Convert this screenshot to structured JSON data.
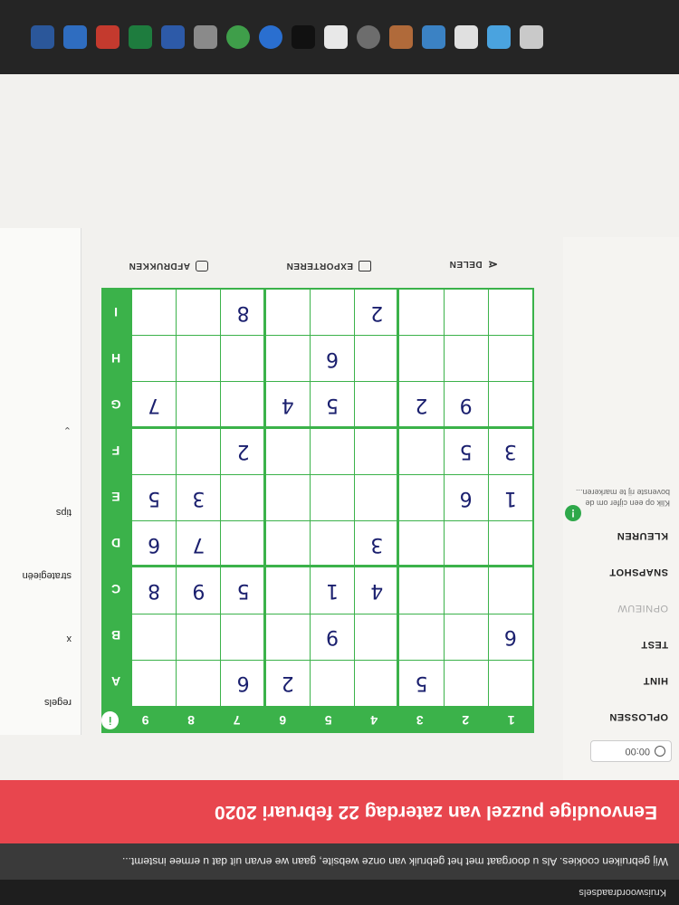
{
  "browser": {
    "tab_title": "Kruiswoordraadsels"
  },
  "cookie_notice": "Wij gebruiken cookies. Als u doorgaat met het gebruik van onze website, gaan we ervan uit dat u ermee instemt...",
  "banner_title": "Eenvoudige puzzel van zaterdag 22 februari 2020",
  "sidebar": {
    "timer": "00:00",
    "buttons": [
      "OPLOSSEN",
      "HINT",
      "TEST",
      "OPNIEUW",
      "SNAPSHOT",
      "KLEUREN"
    ],
    "tip_text": "Klik op een cijfer om de bovenste rij te markeren...",
    "tip_icon": "!"
  },
  "board": {
    "info_icon": "i",
    "columns": [
      "1",
      "2",
      "3",
      "4",
      "5",
      "6",
      "7",
      "8",
      "9"
    ],
    "rows": [
      "A",
      "B",
      "C",
      "D",
      "E",
      "F",
      "G",
      "H",
      "I"
    ],
    "cells": [
      [
        "",
        "",
        "5",
        "",
        "",
        "2",
        "6",
        "",
        ""
      ],
      [
        "6",
        "",
        "",
        "",
        "9",
        "",
        "",
        "",
        ""
      ],
      [
        "",
        "",
        "",
        "4",
        "1",
        "",
        "5",
        "9",
        "8"
      ],
      [
        "",
        "",
        "",
        "3",
        "",
        "",
        "",
        "7",
        "6"
      ],
      [
        "1",
        "6",
        "",
        "",
        "",
        "",
        "",
        "3",
        "5"
      ],
      [
        "3",
        "5",
        "",
        "",
        "",
        "",
        "2",
        "",
        ""
      ],
      [
        "",
        "9",
        "2",
        "",
        "5",
        "4",
        "",
        "",
        "7"
      ],
      [
        "",
        "",
        "",
        "",
        "6",
        "",
        "",
        "",
        ""
      ],
      [
        "",
        "",
        "",
        "2",
        "",
        "",
        "8",
        "",
        ""
      ]
    ]
  },
  "actions": {
    "share": "DELEN",
    "export": "EXPORTEREN",
    "print": "AFDRUKKEN"
  },
  "right_panel": {
    "items": [
      "regels",
      "x",
      "strategieën",
      "tips"
    ]
  },
  "colors": {
    "accent_green": "#3bb24a",
    "banner_red": "#e8464e",
    "digit_navy": "#1a1f6e"
  }
}
